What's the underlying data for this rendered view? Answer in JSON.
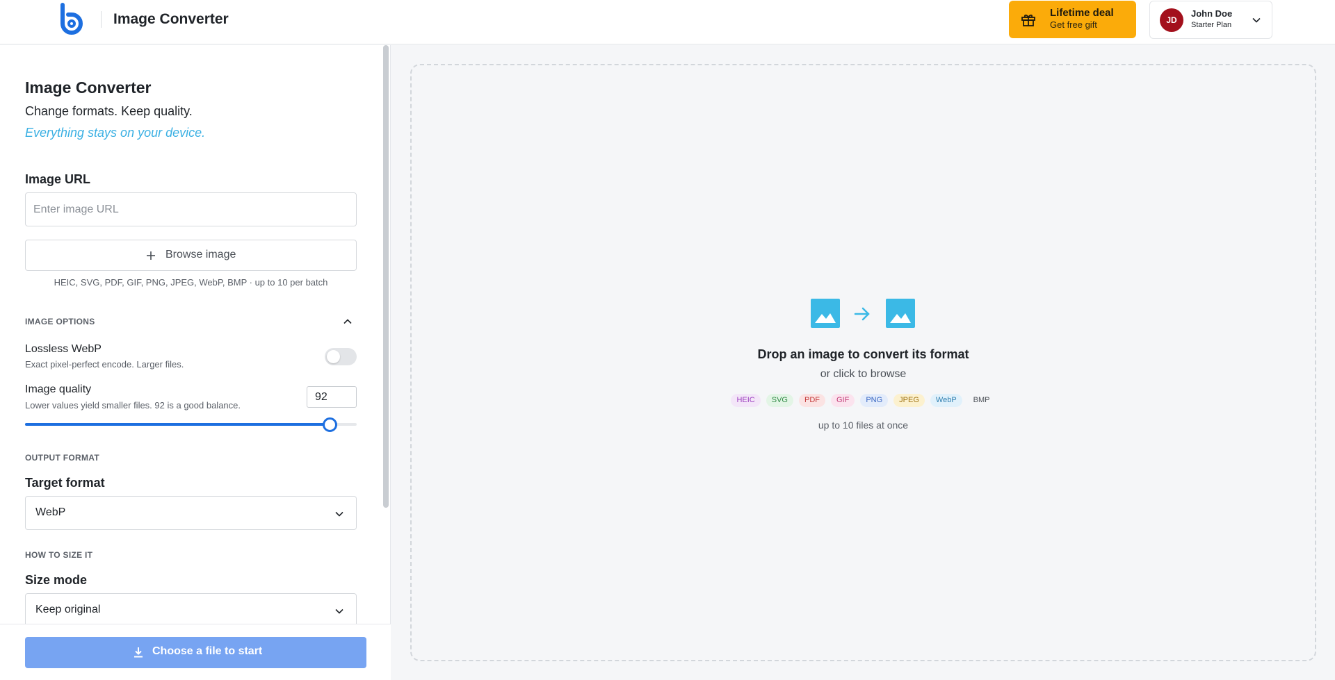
{
  "header": {
    "app_title": "Image Converter",
    "deal": {
      "title": "Lifetime deal",
      "subtitle": "Get free gift"
    },
    "user": {
      "initials": "JD",
      "name": "John Doe",
      "plan": "Starter Plan"
    }
  },
  "sidebar": {
    "title": "Image Converter",
    "subtitle": "Change formats. Keep quality.",
    "note": "Everything stays on your device.",
    "image_url": {
      "label": "Image URL",
      "placeholder": "Enter image URL",
      "value": ""
    },
    "browse_label": "Browse image",
    "formats_note": "HEIC, SVG, PDF, GIF, PNG, JPEG, WebP, BMP · up to 10 per batch",
    "image_options": {
      "caption": "IMAGE OPTIONS",
      "lossless": {
        "label": "Lossless WebP",
        "desc": "Exact pixel-perfect encode. Larger files.",
        "enabled": false
      },
      "quality": {
        "label": "Image quality",
        "desc": "Lower values yield smaller files. 92 is a good balance.",
        "value": "92",
        "percent": 92
      }
    },
    "output_format": {
      "caption": "OUTPUT FORMAT",
      "label": "Target format",
      "value": "WebP"
    },
    "sizing": {
      "caption": "HOW TO SIZE IT",
      "label": "Size mode",
      "value": "Keep original"
    },
    "start_button": "Choose a file to start"
  },
  "dropzone": {
    "title": "Drop an image to convert its format",
    "subtitle": "or click to browse",
    "formats": [
      {
        "label": "HEIC",
        "bg": "#f3e6f8",
        "fg": "#9c3fbf"
      },
      {
        "label": "SVG",
        "bg": "#e3f5e6",
        "fg": "#2f8a44"
      },
      {
        "label": "PDF",
        "bg": "#fbe3e3",
        "fg": "#c43a3a"
      },
      {
        "label": "GIF",
        "bg": "#fbe3ee",
        "fg": "#c23a76"
      },
      {
        "label": "PNG",
        "bg": "#e3ecfb",
        "fg": "#3866c2"
      },
      {
        "label": "JPEG",
        "bg": "#fcf1cf",
        "fg": "#a07414"
      },
      {
        "label": "WebP",
        "bg": "#e1f1fb",
        "fg": "#2f7fb0"
      },
      {
        "label": "BMP",
        "bg": "#f5f6f8",
        "fg": "#4a4f56"
      }
    ],
    "footer": "up to 10 files at once"
  },
  "colors": {
    "accent": "#3bb0e3",
    "primary": "#1d6fe0",
    "deal": "#fbab0a",
    "avatar": "#a3101c"
  }
}
